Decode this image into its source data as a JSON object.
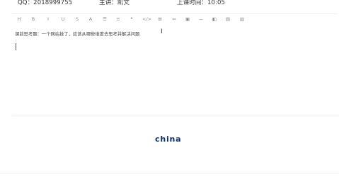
{
  "info": {
    "qq": "QQ：2018999755",
    "lecturer": "主讲：凯文",
    "time": "上课时间：10:05"
  },
  "toolbar": [
    {
      "label": "H",
      "icon": "heading-icon"
    },
    {
      "label": "B",
      "icon": "bold-icon"
    },
    {
      "label": "I",
      "icon": "italic-icon"
    },
    {
      "label": "U",
      "icon": "underline-icon"
    },
    {
      "label": "S",
      "icon": "strikethrough-icon"
    },
    {
      "label": "A",
      "icon": "font-color-icon"
    },
    {
      "label": "☰",
      "icon": "ordered-list-icon"
    },
    {
      "label": "≡",
      "icon": "unordered-list-icon"
    },
    {
      "label": "❝",
      "icon": "quote-icon"
    },
    {
      "label": "</>",
      "icon": "code-icon"
    },
    {
      "label": "⊞",
      "icon": "table-icon"
    },
    {
      "label": "⇔",
      "icon": "link-icon"
    },
    {
      "label": "▣",
      "icon": "image-icon"
    },
    {
      "label": "—",
      "icon": "horizontal-rule-icon"
    },
    {
      "label": "◧",
      "icon": "align-icon"
    },
    {
      "label": "▤",
      "icon": "align-justify-icon"
    },
    {
      "label": "▥",
      "icon": "format-icon"
    },
    {
      "label": "🗑",
      "icon": "clear-icon"
    }
  ],
  "editor": {
    "content": "课前思考题：一个网站挂了，应该从哪些维度去思考并解决问题",
    "cursor_glyph": "I"
  },
  "brand": {
    "text": "china"
  }
}
